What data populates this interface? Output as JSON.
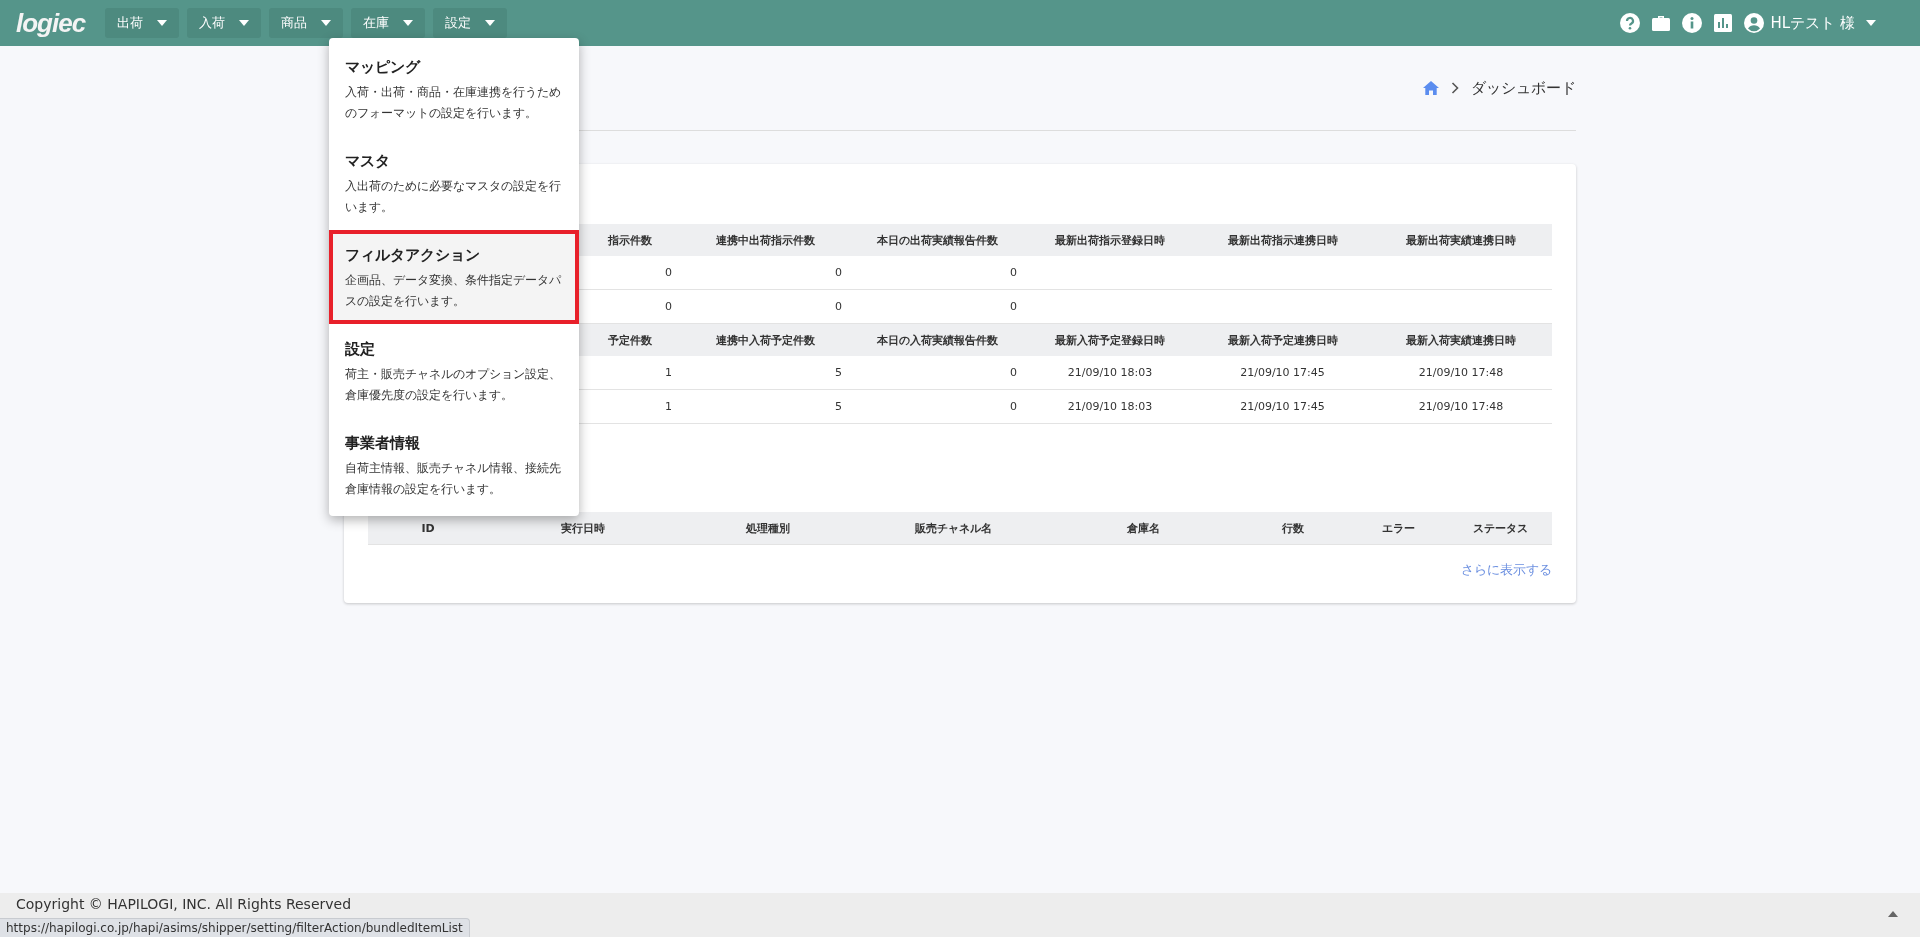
{
  "header": {
    "logo": "logiec",
    "nav": [
      {
        "label": "出荷"
      },
      {
        "label": "入荷"
      },
      {
        "label": "商品"
      },
      {
        "label": "在庫"
      },
      {
        "label": "設定"
      }
    ],
    "user_name": "HLテスト 様"
  },
  "dropdown": {
    "items": [
      {
        "title": "マッピング",
        "description": "入荷・出荷・商品・在庫連携を行うためのフォーマットの設定を行います。",
        "selected": false
      },
      {
        "title": "マスタ",
        "description": "入出荷のために必要なマスタの設定を行います。",
        "selected": false
      },
      {
        "title": "フィルタアクション",
        "description": "企画品、データ変換、条件指定データパスの設定を行います。",
        "selected": true
      },
      {
        "title": "設定",
        "description": "荷主・販売チャネルのオプション設定、倉庫優先度の設定を行います。",
        "selected": false
      },
      {
        "title": "事業者情報",
        "description": "自荷主情報、販売チャネル情報、接続先倉庫情報の設定を行います。",
        "selected": false
      }
    ]
  },
  "breadcrumb": {
    "current": "ダッシュボード"
  },
  "shipping_table": {
    "columns": [
      "指示件数",
      "連携中出荷指示件数",
      "本日の出荷実績報告件数",
      "最新出荷指示登録日時",
      "最新出荷指示連携日時",
      "最新出荷実績連携日時"
    ],
    "rows": [
      {
        "cells": [
          "0",
          "0",
          "0"
        ]
      },
      {
        "cells": [
          "0",
          "0",
          "0"
        ]
      }
    ]
  },
  "receiving_table": {
    "columns": [
      "予定件数",
      "連携中入荷予定件数",
      "本日の入荷実績報告件数",
      "最新入荷予定登録日時",
      "最新入荷予定連携日時",
      "最新入荷実績連携日時"
    ],
    "rows": [
      {
        "cells": [
          "1",
          "5",
          "0",
          "21/09/10 18:03",
          "21/09/10 17:45",
          "21/09/10 17:48"
        ]
      },
      {
        "cells": [
          "1",
          "5",
          "0",
          "21/09/10 18:03",
          "21/09/10 17:45",
          "21/09/10 17:48"
        ]
      }
    ]
  },
  "history_table": {
    "columns": [
      "ID",
      "実行日時",
      "処理種別",
      "販売チャネル名",
      "倉庫名",
      "行数",
      "エラー",
      "ステータス"
    ]
  },
  "more_link": "さらに表示する",
  "footer": {
    "copyright": "Copyright © HAPILOGI, INC. All Rights Reserved"
  },
  "status_url": "https://hapilogi.co.jp/hapi/asims/shipper/setting/filterAction/bundledItemList"
}
